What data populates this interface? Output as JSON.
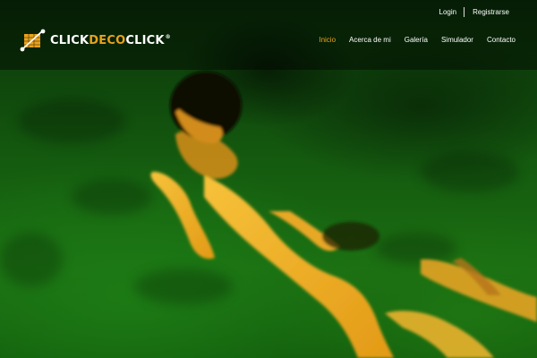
{
  "header": {
    "utility_links": {
      "login": "Login",
      "register": "Registrarse"
    },
    "logo": {
      "part1": "CLICK",
      "part2": "DECO",
      "part3": "CLICK",
      "registered": "®"
    },
    "nav": {
      "items": [
        {
          "label": "Inicio",
          "active": true
        },
        {
          "label": "Acerca de mi",
          "active": false
        },
        {
          "label": "Galería",
          "active": false
        },
        {
          "label": "Simulador",
          "active": false
        },
        {
          "label": "Contacto",
          "active": false
        }
      ]
    }
  },
  "hero": {
    "image": "photo of a swimmer underwater lit in yellow on green pool water"
  },
  "colors": {
    "accent": "#e8a21e",
    "water": "#1b6e12",
    "skin": "#f2b324"
  }
}
